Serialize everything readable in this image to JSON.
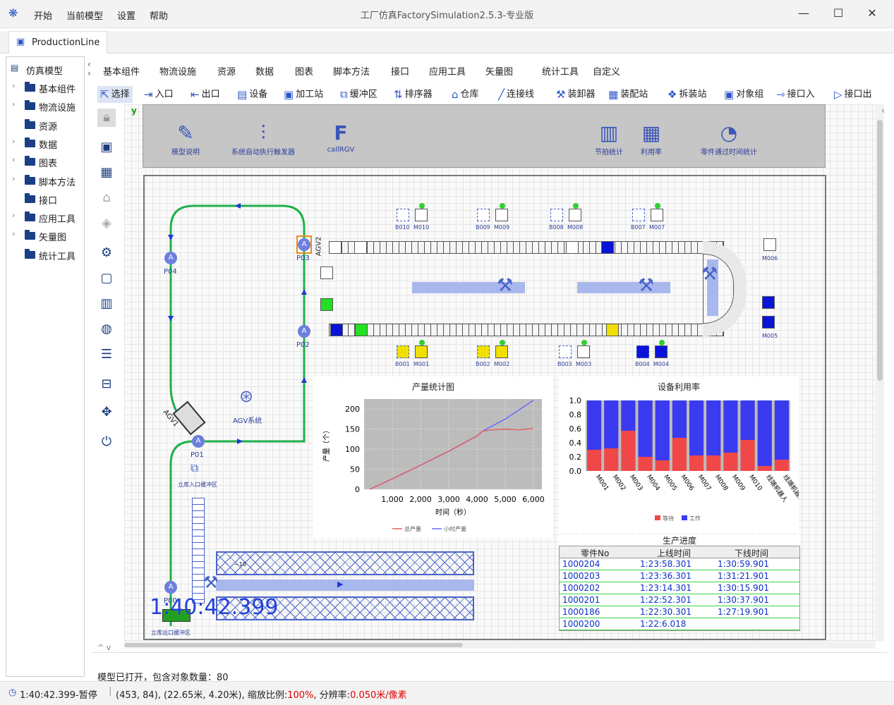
{
  "app": {
    "menus": [
      "开始",
      "当前模型",
      "设置",
      "帮助"
    ],
    "title": "工厂仿真FactorySimulation2.5.3-专业版",
    "window_buttons": {
      "minimize": "—",
      "maximize": "☐",
      "close": "✕"
    }
  },
  "document_tab": "ProductionLine",
  "tree": {
    "root": "仿真模型",
    "items": [
      {
        "label": "基本组件",
        "expandable": true
      },
      {
        "label": "物流设施",
        "expandable": true
      },
      {
        "label": "资源",
        "expandable": false
      },
      {
        "label": "数据",
        "expandable": true
      },
      {
        "label": "图表",
        "expandable": true
      },
      {
        "label": "脚本方法",
        "expandable": true
      },
      {
        "label": "接口",
        "expandable": false
      },
      {
        "label": "应用工具",
        "expandable": true
      },
      {
        "label": "矢量图",
        "expandable": true
      },
      {
        "label": "统计工具",
        "expandable": false
      }
    ]
  },
  "category_tabs": [
    "基本组件",
    "物流设施",
    "资源",
    "数据",
    "图表",
    "脚本方法",
    "接口",
    "应用工具",
    "矢量图",
    "统计工具",
    "自定义"
  ],
  "tools": [
    {
      "label": "选择",
      "icon": "pointer-icon"
    },
    {
      "label": "入口",
      "icon": "entrance-icon"
    },
    {
      "label": "出口",
      "icon": "exit-icon"
    },
    {
      "label": "设备",
      "icon": "equipment-icon"
    },
    {
      "label": "加工站",
      "icon": "workstation-icon"
    },
    {
      "label": "缓冲区",
      "icon": "buffer-icon"
    },
    {
      "label": "排序器",
      "icon": "sorter-icon"
    },
    {
      "label": "仓库",
      "icon": "warehouse-icon"
    },
    {
      "label": "连接线",
      "icon": "connector-icon"
    },
    {
      "label": "装卸器",
      "icon": "loader-icon"
    },
    {
      "label": "装配站",
      "icon": "assembly-icon"
    },
    {
      "label": "拆装站",
      "icon": "disassembly-icon"
    },
    {
      "label": "对象组",
      "icon": "group-icon"
    },
    {
      "label": "接口入",
      "icon": "interface-in-icon"
    },
    {
      "label": "接口出",
      "icon": "interface-out-icon"
    }
  ],
  "panel_buttons": [
    {
      "label": "模型说明",
      "icon": "edit-icon"
    },
    {
      "label": "系统自动执行触发器",
      "icon": "trigger-icon"
    },
    {
      "label": "callRGV",
      "icon": "function-icon"
    },
    {
      "label": "节拍统计",
      "icon": "bar-stat-icon"
    },
    {
      "label": "利用率",
      "icon": "utilization-icon"
    },
    {
      "label": "零件通过时间统计",
      "icon": "pie-stat-icon"
    }
  ],
  "canvas_axis": "y",
  "model_labels": {
    "p04": "P04",
    "p03": "P03",
    "p02": "P02",
    "p01": "P01",
    "p00": "P00",
    "agv1": "AGV1",
    "agv2": "AGV2",
    "agv_system": "AGV系统",
    "entry_buffer": "立库入口缓冲区",
    "exit_buffer": "立库出口缓冲区",
    "rack_count": "~10",
    "machines_top": [
      "B010",
      "M010",
      "B009",
      "M009",
      "B008",
      "M008",
      "B007",
      "M007"
    ],
    "machines_bottom": [
      "B001",
      "M001",
      "B002",
      "M002",
      "B003",
      "M003",
      "B004",
      "M004"
    ],
    "machines_right": [
      "M006",
      "M005"
    ]
  },
  "clock": "1:40:42.399",
  "chart_data": [
    {
      "type": "line",
      "title": "产量统计图",
      "xlabel": "时间（秒）",
      "ylabel": "产量（个）",
      "xlim": [
        0,
        6300
      ],
      "ylim": [
        0,
        225
      ],
      "xticks": [
        "1,000",
        "2,000",
        "3,000",
        "4,000",
        "5,000",
        "6,000"
      ],
      "xtick_values": [
        1000,
        2000,
        3000,
        4000,
        5000,
        6000
      ],
      "yticks": [
        "0",
        "50",
        "100",
        "150",
        "200"
      ],
      "ytick_values": [
        0,
        50,
        100,
        150,
        200
      ],
      "series": [
        {
          "name": "总产量",
          "color": "#e06060",
          "x": [
            200,
            1000,
            2000,
            3000,
            4000,
            4200,
            4500,
            5000,
            5500,
            6000
          ],
          "y": [
            0,
            26,
            60,
            95,
            133,
            145,
            148,
            150,
            148,
            152
          ]
        },
        {
          "name": "小时产量",
          "color": "#6a6aff",
          "x": [
            200,
            1000,
            2000,
            3000,
            4000,
            4200,
            5000,
            6000
          ],
          "y": [
            0,
            26,
            60,
            95,
            133,
            145,
            175,
            222
          ]
        }
      ],
      "legend_position": "bottom"
    },
    {
      "type": "bar",
      "title": "设备利用率",
      "categories": [
        "M001",
        "M002",
        "M003",
        "M004",
        "M005",
        "M006",
        "M007",
        "M008",
        "M009",
        "M010",
        "线端机器人",
        "线端机器人"
      ],
      "ylim": [
        0,
        1.0
      ],
      "yticks": [
        "0.0",
        "0.2",
        "0.4",
        "0.6",
        "0.8",
        "1.0"
      ],
      "ytick_values": [
        0,
        0.2,
        0.4,
        0.6,
        0.8,
        1.0
      ],
      "series": [
        {
          "name": "等待",
          "color": "#f04848",
          "values": [
            0.3,
            0.32,
            0.57,
            0.2,
            0.15,
            0.47,
            0.22,
            0.22,
            0.26,
            0.44,
            0.07,
            0.16
          ]
        },
        {
          "name": "工作",
          "color": "#3a3af0",
          "values": [
            0.7,
            0.68,
            0.43,
            0.8,
            0.85,
            0.53,
            0.78,
            0.78,
            0.74,
            0.56,
            0.93,
            0.84
          ]
        }
      ],
      "legend_position": "bottom"
    }
  ],
  "production_table": {
    "title": "生产进度",
    "columns": [
      "零件No",
      "上线时间",
      "下线时间"
    ],
    "rows": [
      [
        "1000204",
        "1:23:58.301",
        "1:30:59.901"
      ],
      [
        "1000203",
        "1:23:36.301",
        "1:31:21.901"
      ],
      [
        "1000202",
        "1:23:14.301",
        "1:30:15.901"
      ],
      [
        "1000201",
        "1:22:52.301",
        "1:30:37.901"
      ],
      [
        "1000186",
        "1:22:30.301",
        "1:27:19.901"
      ],
      [
        "1000200",
        "1:22:6.018",
        ""
      ]
    ]
  },
  "log_text": "模型已打开，包含对象数量：80",
  "status": {
    "time": "1:40:42.399-暂停",
    "coords": "(453, 84), (22.65米, 4.20米), 缩放比例:",
    "zoom": "100%",
    "resolution_label": ", 分辨率:",
    "resolution": "0.050米/像素",
    "highlight_color": "#e00000"
  }
}
